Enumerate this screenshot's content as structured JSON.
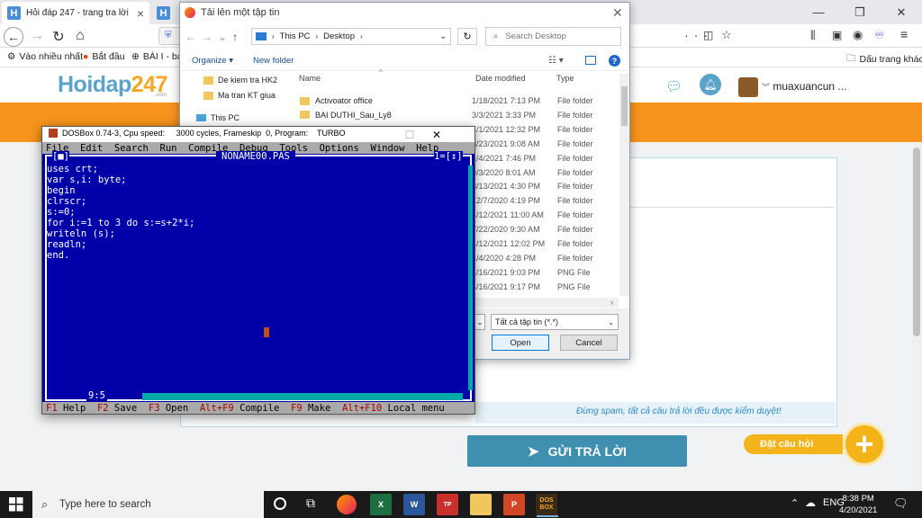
{
  "browser": {
    "tabs": [
      {
        "title": "Hỏi đáp 247 - trang tra lời",
        "icon_letter": "H"
      },
      {
        "title": "H",
        "icon_letter": "H"
      }
    ],
    "bookmarks": [
      "Vào nhiều nhất",
      "Bắt đầu",
      "BÀI I - bai"
    ],
    "bookmark_right": "Dấu trang khác"
  },
  "site": {
    "logo_main": "Hoidap",
    "logo_num": "247",
    "logo_sub": ".com",
    "username": "muaxuancun ...",
    "spam_note": "Đừng spam, tất cả câu trả lời đều được kiểm duyệt!",
    "submit_label": "GỬI TRẢ LỜI",
    "ask_label": "Đặt câu hỏi",
    "colors": {
      "orange": "#f7941d",
      "blue": "#3e8fb0",
      "yellow": "#f5b31a"
    }
  },
  "dialog": {
    "title": "Tải lên một tập tin",
    "path": [
      "This PC",
      "Desktop"
    ],
    "search_placeholder": "Search Desktop",
    "organize": "Organize",
    "new_folder": "New folder",
    "nav_items": [
      "De kiem tra HK2",
      "Ma tran KT giua",
      "This PC"
    ],
    "columns": {
      "name": "Name",
      "date": "Date modified",
      "type": "Type"
    },
    "rows": [
      {
        "name": "Activoator office",
        "date": "1/18/2021 7:13 PM",
        "type": "File folder"
      },
      {
        "name": "BAI DUTHI_Sau_Ly8",
        "date": "3/3/2021 3:33 PM",
        "type": "File folder"
      },
      {
        "name": "",
        "date": "4/1/2021 12:32 PM",
        "type": "File folder"
      },
      {
        "name": "",
        "date": "3/23/2021 9:08 AM",
        "type": "File folder"
      },
      {
        "name": "",
        "date": "1/4/2021 7:46 PM",
        "type": "File folder"
      },
      {
        "name": "",
        "date": "9/3/2020 8:01 AM",
        "type": "File folder"
      },
      {
        "name": "",
        "date": "3/13/2021 4:30 PM",
        "type": "File folder"
      },
      {
        "name": "",
        "date": "12/7/2020 4:19 PM",
        "type": "File folder"
      },
      {
        "name": "",
        "date": "4/12/2021 11:00 AM",
        "type": "File folder"
      },
      {
        "name": "",
        "date": "7/22/2020 9:30 AM",
        "type": "File folder"
      },
      {
        "name": "",
        "date": "4/12/2021 12:02 PM",
        "type": "File folder"
      },
      {
        "name": "",
        "date": "1/4/2020 4:28 PM",
        "type": "File folder"
      },
      {
        "name": "",
        "date": "4/16/2021 9:03 PM",
        "type": "PNG File"
      },
      {
        "name": "",
        "date": "4/16/2021 9:17 PM",
        "type": "PNG File"
      }
    ],
    "filter": "Tất cả tập tin (*.*)",
    "open_label": "Open",
    "cancel_label": "Cancel"
  },
  "dosbox": {
    "title": "DOSBox 0.74-3, Cpu speed:     3000 cycles, Frameskip  0, Program:    TURBO",
    "menu": [
      "File",
      "Edit",
      "Search",
      "Run",
      "Compile",
      "Debug",
      "Tools",
      "Options",
      "Window",
      "Help"
    ],
    "filename": "NONAME00.PAS",
    "close_box": "[■]",
    "window_num": "1=[↕]",
    "code": [
      "uses crt;",
      "var s,i: byte;",
      "begin",
      "clrscr;",
      "s:=0;",
      "for i:=1 to 3 do s:=s+2*i;",
      "writeln (s);",
      "readln;",
      "end."
    ],
    "cursor_pos": "9:5",
    "status": [
      {
        "key": "F1",
        "label": "Help"
      },
      {
        "key": "F2",
        "label": "Save"
      },
      {
        "key": "F3",
        "label": "Open"
      },
      {
        "key": "Alt+F9",
        "label": "Compile"
      },
      {
        "key": "F9",
        "label": "Make"
      },
      {
        "key": "Alt+F10",
        "label": "Local menu"
      }
    ]
  },
  "taskbar": {
    "search_placeholder": "Type here to search",
    "lang": "ENG",
    "time": "8:38 PM",
    "date": "4/20/2021"
  }
}
